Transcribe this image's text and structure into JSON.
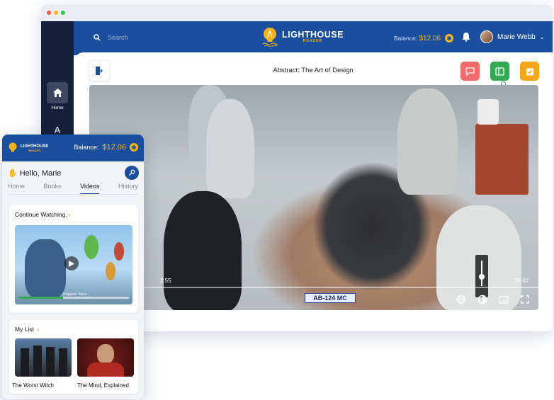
{
  "desktop": {
    "search": {
      "placeholder": "Search"
    },
    "logo": {
      "name": "LIGHTHOUSE",
      "sub": "READER"
    },
    "balance": {
      "label": "Balance:",
      "amount": "$12.06"
    },
    "user": {
      "name": "Marie Webb"
    },
    "sidebar": {
      "items": [
        {
          "label": "Home",
          "icon": "home-icon"
        },
        {
          "label": "",
          "icon": "text-size-icon"
        }
      ]
    },
    "doc_title": "Abstract: The Art of Design",
    "player": {
      "elapsed": "2:55",
      "total": "26:42",
      "progress_fraction": 0.11,
      "volume_fraction": 0.35,
      "license_plate": "AB-124 MC"
    },
    "colors": {
      "brand_blue": "#1c4e9e",
      "accent_gold": "#f5b41b",
      "green": "#34a853",
      "red": "#f06b6b",
      "orange": "#f5a61b",
      "sidebar_dark": "#14203a"
    }
  },
  "mobile": {
    "logo": {
      "name": "LIGHTHOUSE",
      "sub": "READER"
    },
    "balance": {
      "label": "Balance:",
      "amount": "$12.06"
    },
    "greeting": "Hello, Marie",
    "tabs": [
      {
        "label": "Home"
      },
      {
        "label": "Books"
      },
      {
        "label": "Videos",
        "active": true
      },
      {
        "label": "History"
      }
    ],
    "continue_watching": {
      "title": "Continue Watching",
      "thumb_caption": "Dragons: Race...",
      "progress_fraction": 0.4
    },
    "my_list": {
      "title": "My List",
      "items": [
        {
          "title": "The Worst Witch"
        },
        {
          "title": "The Mind, Explained"
        }
      ]
    }
  }
}
